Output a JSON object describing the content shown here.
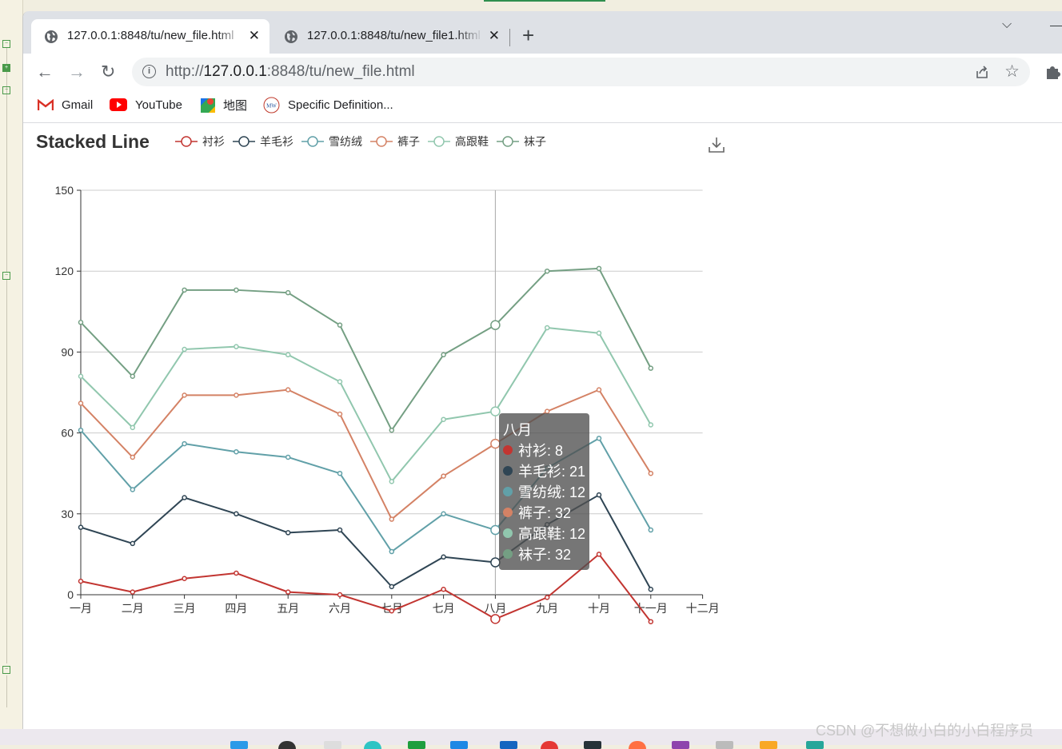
{
  "browser": {
    "tabs": [
      {
        "title": "127.0.0.1:8848/tu/new_file.html"
      },
      {
        "title": "127.0.0.1:8848/tu/new_file1.html"
      }
    ],
    "url_prefix": "http://",
    "url_host": "127.0.0.1",
    "url_rest": ":8848/tu/new_file.html",
    "bookmarks": [
      {
        "label": "Gmail",
        "icon": "gmail-icon"
      },
      {
        "label": "YouTube",
        "icon": "youtube-icon"
      },
      {
        "label": "地图",
        "icon": "maps-icon"
      },
      {
        "label": "Specific Definition...",
        "icon": "mw-icon"
      }
    ]
  },
  "tooltip": {
    "title": "八月",
    "rows": [
      {
        "text": "衬衫: 8",
        "color": "#c23531"
      },
      {
        "text": "羊毛衫: 21",
        "color": "#2f4554"
      },
      {
        "text": "雪纺绒: 12",
        "color": "#61a0a8"
      },
      {
        "text": "裤子: 32",
        "color": "#d48265"
      },
      {
        "text": "高跟鞋: 12",
        "color": "#91c7ae"
      },
      {
        "text": "袜子: 32",
        "color": "#749f83"
      }
    ]
  },
  "watermark": "CSDN @不想做小白的小白程序员",
  "chart_data": {
    "type": "line",
    "stacked": true,
    "title": "Stacked Line",
    "xlabel": "",
    "ylabel": "",
    "categories": [
      "一月",
      "二月",
      "三月",
      "四月",
      "五月",
      "六月",
      "七月",
      "七月",
      "八月",
      "九月",
      "十月",
      "十一月",
      "十二月"
    ],
    "ylim": [
      0,
      150
    ],
    "yticks": [
      0,
      30,
      60,
      90,
      120,
      150
    ],
    "grid": "horizontal",
    "legend_position": "top",
    "series": [
      {
        "name": "衬衫",
        "color": "#c23531",
        "values": [
          5,
          1,
          6,
          8,
          1,
          0,
          -6,
          2,
          -9,
          -1,
          15,
          -10
        ]
      },
      {
        "name": "羊毛衫",
        "color": "#2f4554",
        "values": [
          20,
          18,
          30,
          22,
          22,
          24,
          9,
          12,
          21,
          27,
          22,
          12
        ]
      },
      {
        "name": "雪纺绒",
        "color": "#61a0a8",
        "values": [
          36,
          20,
          20,
          23,
          28,
          21,
          13,
          16,
          12,
          21,
          21,
          22
        ]
      },
      {
        "name": "裤子",
        "color": "#d48265",
        "values": [
          10,
          12,
          18,
          21,
          25,
          22,
          12,
          14,
          32,
          21,
          18,
          21
        ]
      },
      {
        "name": "高跟鞋",
        "color": "#91c7ae",
        "values": [
          10,
          11,
          17,
          18,
          13,
          12,
          14,
          21,
          12,
          31,
          21,
          18
        ]
      },
      {
        "name": "袜子",
        "color": "#749f83",
        "values": [
          20,
          19,
          22,
          21,
          23,
          21,
          19,
          24,
          32,
          21,
          24,
          21
        ]
      }
    ],
    "highlight_index": 8
  }
}
